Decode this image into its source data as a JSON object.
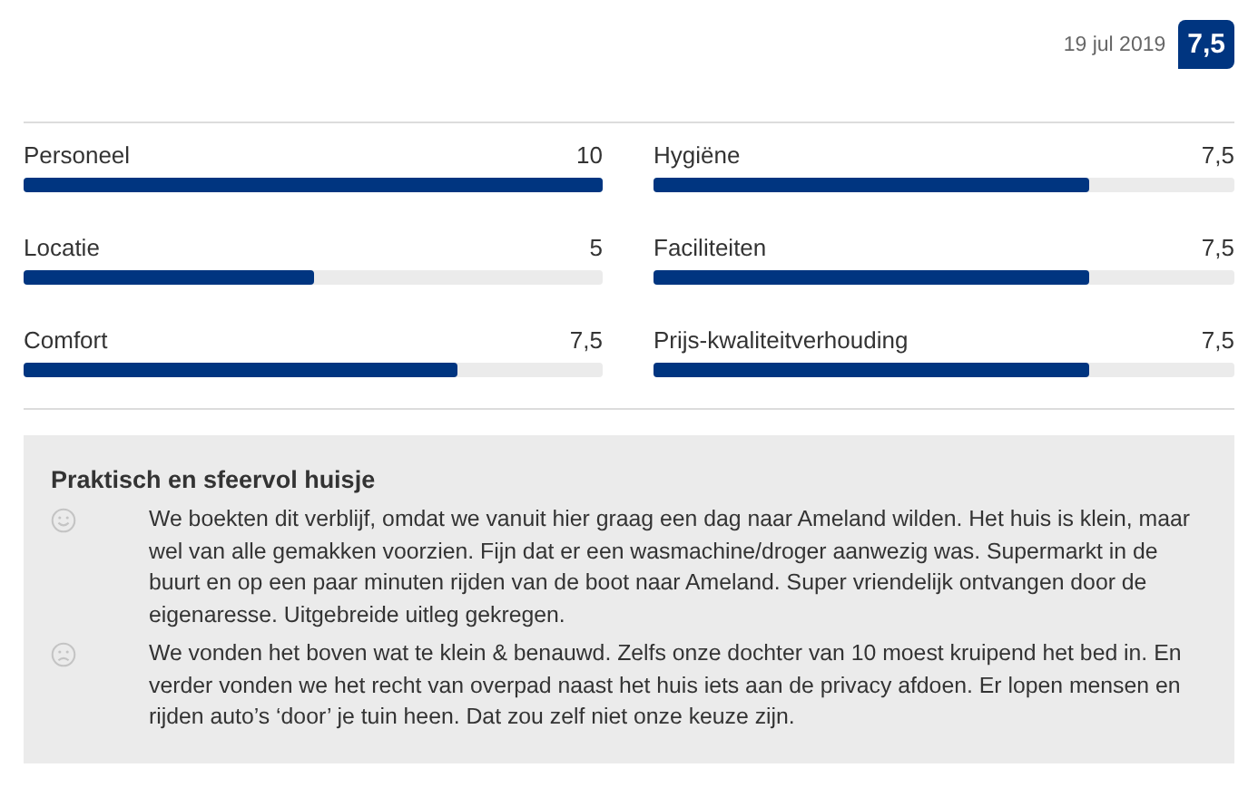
{
  "review_date": "19 jul 2019",
  "score": "7,5",
  "categories": [
    {
      "name": "Personeel",
      "score": "10",
      "level": 1.0
    },
    {
      "name": "Hygiëne",
      "score": "7,5",
      "level": 0.75
    },
    {
      "name": "Locatie",
      "score": "5",
      "level": 0.5
    },
    {
      "name": "Faciliteiten",
      "score": "7,5",
      "level": 0.75
    },
    {
      "name": "Comfort",
      "score": "7,5",
      "level": 0.75
    },
    {
      "name": "Prijs-kwaliteitverhouding",
      "score": "7,5",
      "level": 0.75
    }
  ],
  "review": {
    "title": "Praktisch en sfeervol huisje",
    "comments": [
      {
        "kind": "positive",
        "text": "We boekten dit verblijf, omdat we vanuit hier graag een dag naar Ameland wilden. Het huis is klein, maar wel van alle gemakken voorzien. Fijn dat er een wasmachine/droger aanwezig was. Supermarkt in de buurt en op een paar minuten rijden van de boot naar Ameland. Super vriendelijk ontvangen door de eigenaresse. Uitgebreide uitleg gekregen."
      },
      {
        "kind": "negative",
        "text": "We vonden het boven wat te klein & benauwd. Zelfs onze dochter van 10 moest kruipend het bed in. En verder vonden we het recht van overpad naast het huis iets aan de privacy afdoen. Er lopen mensen en rijden auto’s ‘door’ je tuin heen. Dat zou zelf niet onze keuze zijn."
      }
    ]
  }
}
